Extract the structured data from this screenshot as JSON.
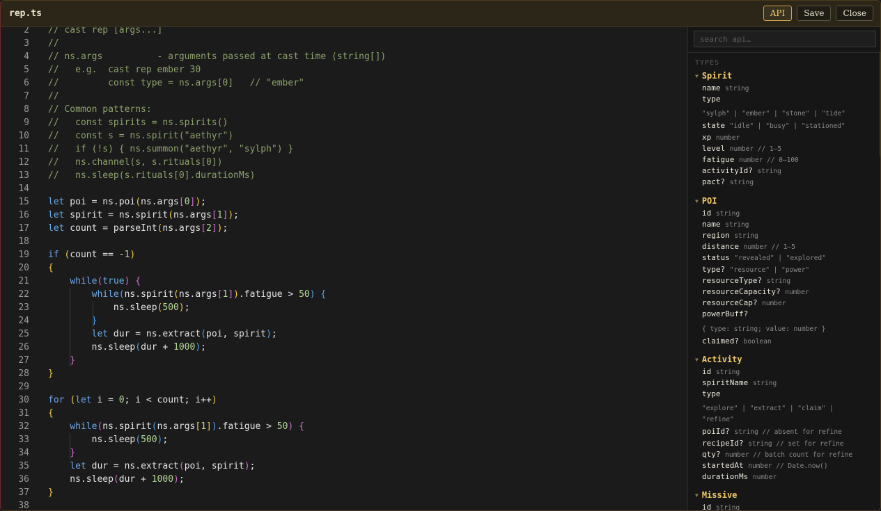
{
  "window": {
    "title": "rep.ts"
  },
  "toolbar": {
    "api_label": "API",
    "save_label": "Save",
    "close_label": "Close"
  },
  "editor": {
    "lines": [
      {
        "n": "2",
        "segs": [
          {
            "c": "cm",
            "t": "// cast rep [args...]"
          }
        ]
      },
      {
        "n": "3",
        "segs": [
          {
            "c": "cm",
            "t": "//"
          }
        ]
      },
      {
        "n": "4",
        "segs": [
          {
            "c": "cm",
            "t": "// ns.args          - arguments passed at cast time (string[])"
          }
        ]
      },
      {
        "n": "5",
        "segs": [
          {
            "c": "cm",
            "t": "//   e.g.  cast rep ember 30"
          }
        ]
      },
      {
        "n": "6",
        "segs": [
          {
            "c": "cm",
            "t": "//         const type = ns.args[0]   // \"ember\""
          }
        ]
      },
      {
        "n": "7",
        "segs": [
          {
            "c": "cm",
            "t": "//"
          }
        ]
      },
      {
        "n": "8",
        "segs": [
          {
            "c": "cm",
            "t": "// Common patterns:"
          }
        ]
      },
      {
        "n": "9",
        "segs": [
          {
            "c": "cm",
            "t": "//   const spirits = ns.spirits()"
          }
        ]
      },
      {
        "n": "10",
        "segs": [
          {
            "c": "cm",
            "t": "//   const s = ns.spirit(\"aethyr\")"
          }
        ]
      },
      {
        "n": "11",
        "segs": [
          {
            "c": "cm",
            "t": "//   if (!s) { ns.summon(\"aethyr\", \"sylph\") }"
          }
        ]
      },
      {
        "n": "12",
        "segs": [
          {
            "c": "cm",
            "t": "//   ns.channel(s, s.rituals[0])"
          }
        ]
      },
      {
        "n": "13",
        "segs": [
          {
            "c": "cm",
            "t": "//   ns.sleep(s.rituals[0].durationMs)"
          }
        ]
      },
      {
        "n": "14",
        "segs": []
      },
      {
        "n": "15",
        "segs": [
          {
            "c": "kw",
            "t": "let"
          },
          {
            "c": "",
            "t": " poi = ns.poi"
          },
          {
            "c": "br1",
            "t": "("
          },
          {
            "c": "",
            "t": "ns.args"
          },
          {
            "c": "br2",
            "t": "["
          },
          {
            "c": "num",
            "t": "0"
          },
          {
            "c": "br2",
            "t": "]"
          },
          {
            "c": "br1",
            "t": ")"
          },
          {
            "c": "",
            "t": ";"
          }
        ]
      },
      {
        "n": "16",
        "segs": [
          {
            "c": "kw",
            "t": "let"
          },
          {
            "c": "",
            "t": " spirit = ns.spirit"
          },
          {
            "c": "br1",
            "t": "("
          },
          {
            "c": "",
            "t": "ns.args"
          },
          {
            "c": "br2",
            "t": "["
          },
          {
            "c": "num",
            "t": "1"
          },
          {
            "c": "br2",
            "t": "]"
          },
          {
            "c": "br1",
            "t": ")"
          },
          {
            "c": "",
            "t": ";"
          }
        ]
      },
      {
        "n": "17",
        "segs": [
          {
            "c": "kw",
            "t": "let"
          },
          {
            "c": "",
            "t": " count = parseInt"
          },
          {
            "c": "br1",
            "t": "("
          },
          {
            "c": "",
            "t": "ns.args"
          },
          {
            "c": "br2",
            "t": "["
          },
          {
            "c": "num",
            "t": "2"
          },
          {
            "c": "br2",
            "t": "]"
          },
          {
            "c": "br1",
            "t": ")"
          },
          {
            "c": "",
            "t": ";"
          }
        ]
      },
      {
        "n": "18",
        "segs": []
      },
      {
        "n": "19",
        "segs": [
          {
            "c": "kw",
            "t": "if"
          },
          {
            "c": "",
            "t": " "
          },
          {
            "c": "br1",
            "t": "("
          },
          {
            "c": "",
            "t": "count == -"
          },
          {
            "c": "num",
            "t": "1"
          },
          {
            "c": "br1",
            "t": ")"
          }
        ]
      },
      {
        "n": "20",
        "segs": [
          {
            "c": "br1",
            "t": "{"
          }
        ]
      },
      {
        "n": "21",
        "segs": [
          {
            "c": "",
            "t": "    "
          },
          {
            "c": "kw",
            "t": "while"
          },
          {
            "c": "br2",
            "t": "("
          },
          {
            "c": "kw",
            "t": "true"
          },
          {
            "c": "br2",
            "t": ")"
          },
          {
            "c": "",
            "t": " "
          },
          {
            "c": "br2",
            "t": "{"
          }
        ]
      },
      {
        "n": "22",
        "segs": [
          {
            "c": "",
            "t": "        "
          },
          {
            "c": "kw",
            "t": "while"
          },
          {
            "c": "br3",
            "t": "("
          },
          {
            "c": "",
            "t": "ns.spirit"
          },
          {
            "c": "br1",
            "t": "("
          },
          {
            "c": "",
            "t": "ns.args"
          },
          {
            "c": "br2",
            "t": "["
          },
          {
            "c": "num",
            "t": "1"
          },
          {
            "c": "br2",
            "t": "]"
          },
          {
            "c": "br1",
            "t": ")"
          },
          {
            "c": "",
            "t": ".fatigue > "
          },
          {
            "c": "num",
            "t": "50"
          },
          {
            "c": "br3",
            "t": ")"
          },
          {
            "c": "",
            "t": " "
          },
          {
            "c": "br3",
            "t": "{"
          }
        ]
      },
      {
        "n": "23",
        "segs": [
          {
            "c": "",
            "t": "            ns.sleep"
          },
          {
            "c": "br1",
            "t": "("
          },
          {
            "c": "num",
            "t": "500"
          },
          {
            "c": "br1",
            "t": ")"
          },
          {
            "c": "",
            "t": ";"
          }
        ]
      },
      {
        "n": "24",
        "segs": [
          {
            "c": "",
            "t": "        "
          },
          {
            "c": "br3",
            "t": "}"
          }
        ]
      },
      {
        "n": "25",
        "segs": [
          {
            "c": "",
            "t": "        "
          },
          {
            "c": "kw",
            "t": "let"
          },
          {
            "c": "",
            "t": " dur = ns.extract"
          },
          {
            "c": "br3",
            "t": "("
          },
          {
            "c": "",
            "t": "poi, spirit"
          },
          {
            "c": "br3",
            "t": ")"
          },
          {
            "c": "",
            "t": ";"
          }
        ]
      },
      {
        "n": "26",
        "segs": [
          {
            "c": "",
            "t": "        ns.sleep"
          },
          {
            "c": "br3",
            "t": "("
          },
          {
            "c": "",
            "t": "dur + "
          },
          {
            "c": "num",
            "t": "1000"
          },
          {
            "c": "br3",
            "t": ")"
          },
          {
            "c": "",
            "t": ";"
          }
        ]
      },
      {
        "n": "27",
        "segs": [
          {
            "c": "",
            "t": "    "
          },
          {
            "c": "br2",
            "t": "}"
          }
        ]
      },
      {
        "n": "28",
        "segs": [
          {
            "c": "br1",
            "t": "}"
          }
        ]
      },
      {
        "n": "29",
        "segs": []
      },
      {
        "n": "30",
        "segs": [
          {
            "c": "kw",
            "t": "for"
          },
          {
            "c": "",
            "t": " "
          },
          {
            "c": "br1",
            "t": "("
          },
          {
            "c": "kw",
            "t": "let"
          },
          {
            "c": "",
            "t": " i = "
          },
          {
            "c": "num",
            "t": "0"
          },
          {
            "c": "",
            "t": "; i < count; i++"
          },
          {
            "c": "br1",
            "t": ")"
          }
        ]
      },
      {
        "n": "31",
        "segs": [
          {
            "c": "br1",
            "t": "{"
          }
        ]
      },
      {
        "n": "32",
        "segs": [
          {
            "c": "",
            "t": "    "
          },
          {
            "c": "kw",
            "t": "while"
          },
          {
            "c": "br2",
            "t": "("
          },
          {
            "c": "",
            "t": "ns.spirit"
          },
          {
            "c": "br3",
            "t": "("
          },
          {
            "c": "",
            "t": "ns.args"
          },
          {
            "c": "br1",
            "t": "["
          },
          {
            "c": "num",
            "t": "1"
          },
          {
            "c": "br1",
            "t": "]"
          },
          {
            "c": "br3",
            "t": ")"
          },
          {
            "c": "",
            "t": ".fatigue > "
          },
          {
            "c": "num",
            "t": "50"
          },
          {
            "c": "br2",
            "t": ")"
          },
          {
            "c": "",
            "t": " "
          },
          {
            "c": "br2",
            "t": "{"
          }
        ]
      },
      {
        "n": "33",
        "segs": [
          {
            "c": "",
            "t": "        ns.sleep"
          },
          {
            "c": "br3",
            "t": "("
          },
          {
            "c": "num",
            "t": "500"
          },
          {
            "c": "br3",
            "t": ")"
          },
          {
            "c": "",
            "t": ";"
          }
        ]
      },
      {
        "n": "34",
        "segs": [
          {
            "c": "",
            "t": "    "
          },
          {
            "c": "br2",
            "t": "}"
          }
        ]
      },
      {
        "n": "35",
        "segs": [
          {
            "c": "",
            "t": "    "
          },
          {
            "c": "kw",
            "t": "let"
          },
          {
            "c": "",
            "t": " dur = ns.extract"
          },
          {
            "c": "br2",
            "t": "("
          },
          {
            "c": "",
            "t": "poi, spirit"
          },
          {
            "c": "br2",
            "t": ")"
          },
          {
            "c": "",
            "t": ";"
          }
        ]
      },
      {
        "n": "36",
        "segs": [
          {
            "c": "",
            "t": "    ns.sleep"
          },
          {
            "c": "br2",
            "t": "("
          },
          {
            "c": "",
            "t": "dur + "
          },
          {
            "c": "num",
            "t": "1000"
          },
          {
            "c": "br2",
            "t": ")"
          },
          {
            "c": "",
            "t": ";"
          }
        ]
      },
      {
        "n": "37",
        "segs": [
          {
            "c": "br1",
            "t": "}"
          }
        ]
      },
      {
        "n": "38",
        "segs": []
      }
    ]
  },
  "api": {
    "search_placeholder": "search api…",
    "section_label": "TYPES",
    "types": [
      {
        "name": "Spirit",
        "rows": [
          {
            "k": "f",
            "name": "name",
            "type": "string"
          },
          {
            "k": "f",
            "name": "type",
            "type": ""
          },
          {
            "k": "t",
            "text": "\"sylph\" | \"ember\" | \"stone\" | \"tide\""
          },
          {
            "k": "f",
            "name": "state",
            "type": "\"idle\" | \"busy\" | \"stationed\""
          },
          {
            "k": "f",
            "name": "xp",
            "type": "number"
          },
          {
            "k": "f",
            "name": "level",
            "type": "number // 1–5"
          },
          {
            "k": "f",
            "name": "fatigue",
            "type": "number // 0–100"
          },
          {
            "k": "f",
            "name": "activityId?",
            "type": "string"
          },
          {
            "k": "f",
            "name": "pact?",
            "type": "string"
          }
        ]
      },
      {
        "name": "POI",
        "rows": [
          {
            "k": "f",
            "name": "id",
            "type": "string"
          },
          {
            "k": "f",
            "name": "name",
            "type": "string"
          },
          {
            "k": "f",
            "name": "region",
            "type": "string"
          },
          {
            "k": "f",
            "name": "distance",
            "type": "number // 1–5"
          },
          {
            "k": "f",
            "name": "status",
            "type": "\"revealed\" | \"explored\""
          },
          {
            "k": "f",
            "name": "type?",
            "type": "\"resource\" | \"power\""
          },
          {
            "k": "f",
            "name": "resourceType?",
            "type": "string"
          },
          {
            "k": "f",
            "name": "resourceCapacity?",
            "type": "number"
          },
          {
            "k": "f",
            "name": "resourceCap?",
            "type": "number"
          },
          {
            "k": "f",
            "name": "powerBuff?",
            "type": ""
          },
          {
            "k": "t",
            "text": "{ type: string; value: number }"
          },
          {
            "k": "f",
            "name": "claimed?",
            "type": "boolean"
          }
        ]
      },
      {
        "name": "Activity",
        "rows": [
          {
            "k": "f",
            "name": "id",
            "type": "string"
          },
          {
            "k": "f",
            "name": "spiritName",
            "type": "string"
          },
          {
            "k": "f",
            "name": "type",
            "type": ""
          },
          {
            "k": "t",
            "text": "\"explore\" | \"extract\" | \"claim\" |"
          },
          {
            "k": "t2",
            "text": "\"refine\""
          },
          {
            "k": "f",
            "name": "poiId?",
            "type": "string // absent for refine"
          },
          {
            "k": "f",
            "name": "recipeId?",
            "type": "string // set for refine"
          },
          {
            "k": "f",
            "name": "qty?",
            "type": "number // batch count for refine"
          },
          {
            "k": "f",
            "name": "startedAt",
            "type": "number // Date.now()"
          },
          {
            "k": "f",
            "name": "durationMs",
            "type": "number"
          }
        ]
      },
      {
        "name": "Missive",
        "rows": [
          {
            "k": "f",
            "name": "id",
            "type": "string"
          }
        ]
      }
    ]
  }
}
